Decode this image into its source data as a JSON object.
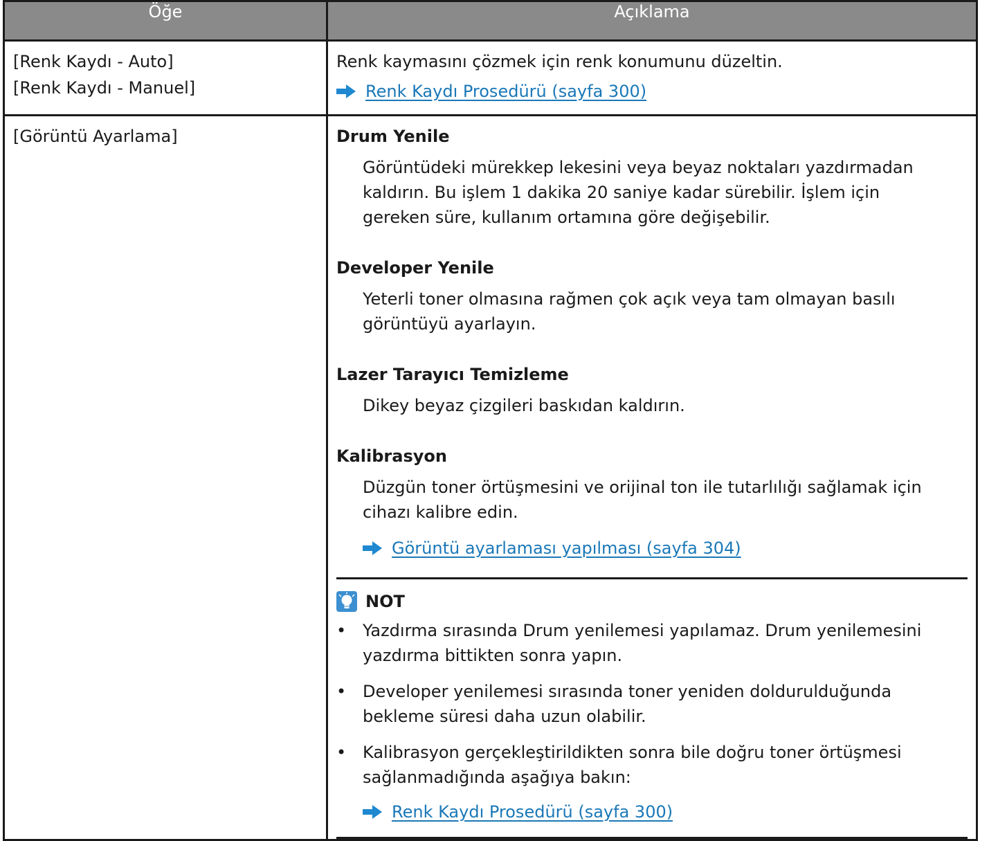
{
  "table": {
    "headers": {
      "item": "Öğe",
      "description": "Açıklama"
    },
    "rows": [
      {
        "items": [
          "[Renk Kaydı - Auto]",
          "[Renk Kaydı - Manuel]"
        ],
        "description": "Renk kaymasını çözmek için renk konumunu düzeltin.",
        "link": "Renk Kaydı Prosedürü (sayfa 300)"
      },
      {
        "items": [
          "[Görüntü Ayarlama]"
        ],
        "sections": [
          {
            "title": "Drum Yenile",
            "lines": [
              "Görüntüdeki mürekkep lekesini veya beyaz noktaları yazdırmadan",
              "kaldırın. Bu işlem 1 dakika 20 saniye kadar sürebilir. İşlem için",
              "gereken süre, kullanım ortamına göre değişebilir."
            ]
          },
          {
            "title": "Developer Yenile",
            "lines": [
              "Yeterli toner olmasına rağmen çok açık veya tam olmayan basılı",
              "görüntüyü ayarlayın."
            ]
          },
          {
            "title": "Lazer Tarayıcı Temizleme",
            "lines": [
              "Dikey beyaz çizgileri baskıdan kaldırın."
            ]
          },
          {
            "title": "Kalibrasyon",
            "lines": [
              "Düzgün toner örtüşmesini ve orijinal ton ile tutarlılığı sağlamak için",
              "cihazı kalibre edin."
            ],
            "link": "Görüntü ayarlaması yapılması (sayfa 304)"
          }
        ],
        "note": {
          "title": "NOT",
          "icon": "lightbulb-icon",
          "bullets": [
            [
              "Yazdırma sırasında Drum yenilemesi yapılamaz. Drum yenilemesini",
              "yazdırma bittikten sonra yapın."
            ],
            [
              "Developer yenilemesi sırasında toner yeniden doldurulduğunda",
              "bekleme süresi daha uzun olabilir."
            ],
            [
              "Kalibrasyon gerçekleştirildikten sonra bile doğru toner örtüşmesi",
              "sağlanmadığında aşağıya bakın:"
            ]
          ],
          "link": "Renk Kaydı Prosedürü (sayfa 300)"
        }
      }
    ]
  },
  "colors": {
    "header_bg": "#8a8a8a",
    "link": "#1a78b8",
    "arrow": "#1e88d0"
  },
  "bullet_char": "•"
}
